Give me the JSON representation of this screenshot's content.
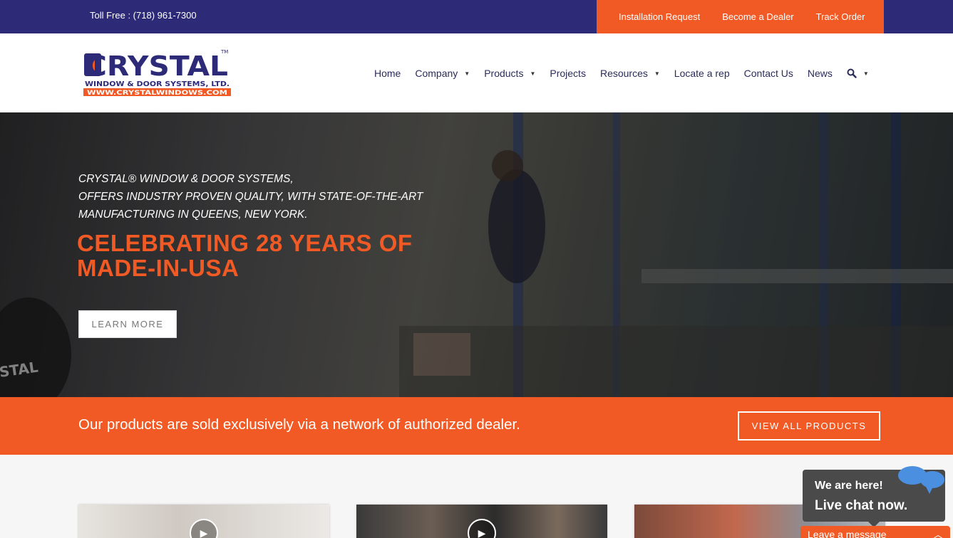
{
  "topbar": {
    "phone": "Toll Free : (718) 961-7300",
    "links": [
      "Installation Request",
      "Become a Dealer",
      "Track Order"
    ]
  },
  "logo": {
    "name": "CRYSTAL",
    "tm": "TM",
    "subtitle": "WINDOW & DOOR SYSTEMS, LTD.",
    "url": "WWW.CRYSTALWINDOWS.COM"
  },
  "nav": {
    "home": "Home",
    "company": "Company",
    "products": "Products",
    "projects": "Projects",
    "resources": "Resources",
    "locate": "Locate a rep",
    "contact": "Contact Us",
    "news": "News"
  },
  "hero": {
    "tagline_1": "CRYSTAL® WINDOW & DOOR SYSTEMS,",
    "tagline_2": "OFFERS INDUSTRY PROVEN QUALITY, WITH STATE-OF-THE-ART",
    "tagline_3": "MANUFACTURING IN QUEENS, NEW YORK.",
    "headline_1": "CELEBRATING 28 YEARS OF",
    "headline_2": "MADE-IN-USA",
    "cta": "LEARN MORE",
    "worker_shirt": "STAL"
  },
  "band": {
    "text": "Our products are sold exclusively via a network of authorized dealer.",
    "button": "VIEW ALL PRODUCTS"
  },
  "chat": {
    "line1": "We are here!",
    "line2": "Live chat now.",
    "leave": "Leave a message"
  },
  "colors": {
    "navy": "#2d2a78",
    "orange": "#f15a24"
  }
}
